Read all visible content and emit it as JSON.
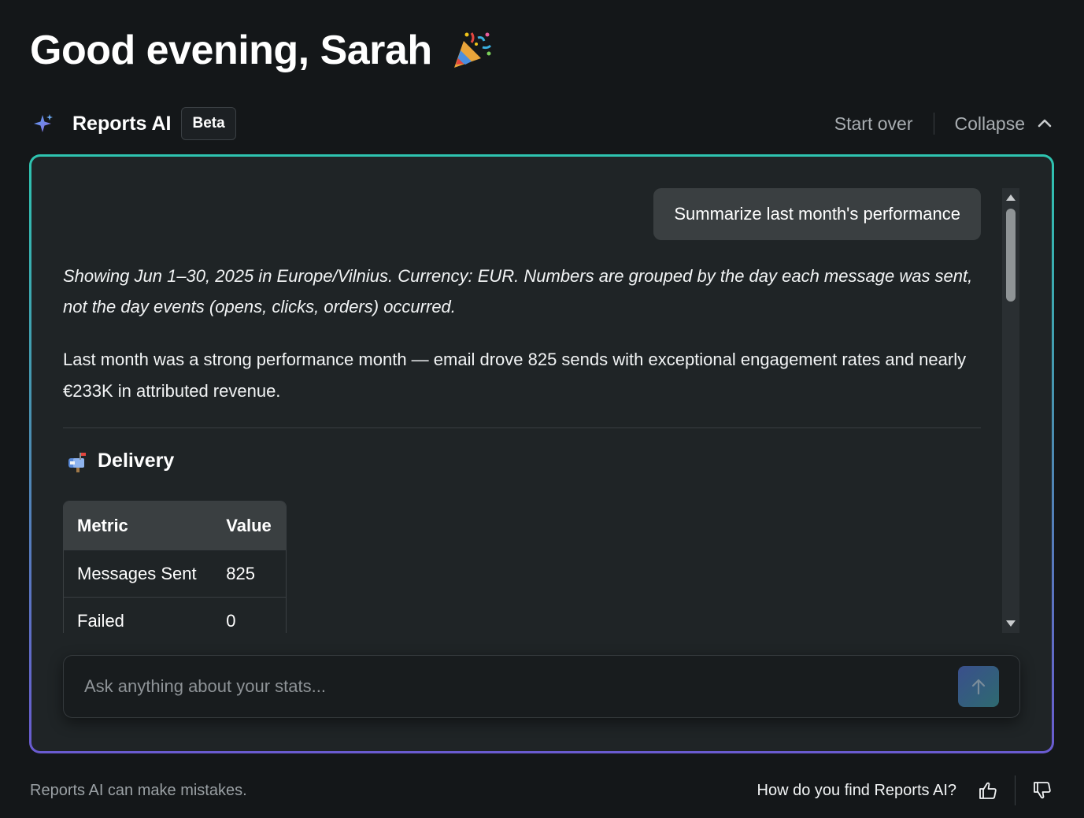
{
  "greeting": {
    "text": "Good evening, Sarah",
    "icon": "party-popper-icon"
  },
  "header": {
    "brand": "Reports AI",
    "badge": "Beta",
    "start_over": "Start over",
    "collapse": "Collapse"
  },
  "chat": {
    "user_message": "Summarize last month's performance",
    "note": "Showing Jun 1–30, 2025 in Europe/Vilnius. Currency: EUR. Numbers are grouped by the day each message was sent, not the day events (opens, clicks, orders) occurred.",
    "summary": "Last month was a strong performance month — email drove 825 sends with exceptional engagement rates and nearly €233K in attributed revenue.",
    "section": {
      "title": "Delivery",
      "icon": "mailbox-icon"
    },
    "table": {
      "headers": [
        "Metric",
        "Value"
      ],
      "rows": [
        [
          "Messages Sent",
          "825"
        ],
        [
          "Failed",
          "0"
        ]
      ]
    }
  },
  "input": {
    "placeholder": "Ask anything about your stats..."
  },
  "footer": {
    "disclaimer": "Reports AI can make mistakes.",
    "feedback_question": "How do you find Reports AI?"
  },
  "colors": {
    "background": "#141719",
    "panel": "#1f2426",
    "border_gradient_top": "#2ec4b0",
    "border_gradient_bottom": "#6a5bd0"
  }
}
